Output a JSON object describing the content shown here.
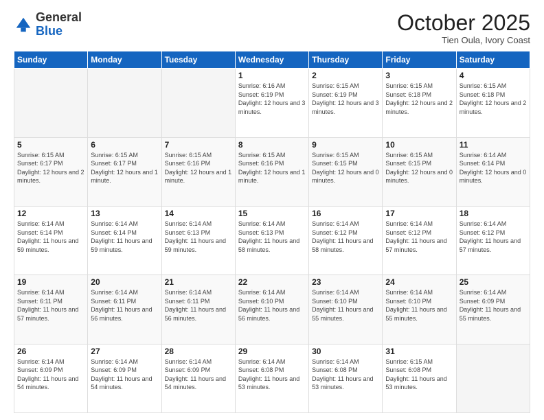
{
  "header": {
    "logo_general": "General",
    "logo_blue": "Blue",
    "month": "October 2025",
    "location": "Tien Oula, Ivory Coast"
  },
  "days_of_week": [
    "Sunday",
    "Monday",
    "Tuesday",
    "Wednesday",
    "Thursday",
    "Friday",
    "Saturday"
  ],
  "weeks": [
    [
      {
        "day": "",
        "info": ""
      },
      {
        "day": "",
        "info": ""
      },
      {
        "day": "",
        "info": ""
      },
      {
        "day": "1",
        "info": "Sunrise: 6:16 AM\nSunset: 6:19 PM\nDaylight: 12 hours and 3 minutes."
      },
      {
        "day": "2",
        "info": "Sunrise: 6:15 AM\nSunset: 6:19 PM\nDaylight: 12 hours and 3 minutes."
      },
      {
        "day": "3",
        "info": "Sunrise: 6:15 AM\nSunset: 6:18 PM\nDaylight: 12 hours and 2 minutes."
      },
      {
        "day": "4",
        "info": "Sunrise: 6:15 AM\nSunset: 6:18 PM\nDaylight: 12 hours and 2 minutes."
      }
    ],
    [
      {
        "day": "5",
        "info": "Sunrise: 6:15 AM\nSunset: 6:17 PM\nDaylight: 12 hours and 2 minutes."
      },
      {
        "day": "6",
        "info": "Sunrise: 6:15 AM\nSunset: 6:17 PM\nDaylight: 12 hours and 1 minute."
      },
      {
        "day": "7",
        "info": "Sunrise: 6:15 AM\nSunset: 6:16 PM\nDaylight: 12 hours and 1 minute."
      },
      {
        "day": "8",
        "info": "Sunrise: 6:15 AM\nSunset: 6:16 PM\nDaylight: 12 hours and 1 minute."
      },
      {
        "day": "9",
        "info": "Sunrise: 6:15 AM\nSunset: 6:15 PM\nDaylight: 12 hours and 0 minutes."
      },
      {
        "day": "10",
        "info": "Sunrise: 6:15 AM\nSunset: 6:15 PM\nDaylight: 12 hours and 0 minutes."
      },
      {
        "day": "11",
        "info": "Sunrise: 6:14 AM\nSunset: 6:14 PM\nDaylight: 12 hours and 0 minutes."
      }
    ],
    [
      {
        "day": "12",
        "info": "Sunrise: 6:14 AM\nSunset: 6:14 PM\nDaylight: 11 hours and 59 minutes."
      },
      {
        "day": "13",
        "info": "Sunrise: 6:14 AM\nSunset: 6:14 PM\nDaylight: 11 hours and 59 minutes."
      },
      {
        "day": "14",
        "info": "Sunrise: 6:14 AM\nSunset: 6:13 PM\nDaylight: 11 hours and 59 minutes."
      },
      {
        "day": "15",
        "info": "Sunrise: 6:14 AM\nSunset: 6:13 PM\nDaylight: 11 hours and 58 minutes."
      },
      {
        "day": "16",
        "info": "Sunrise: 6:14 AM\nSunset: 6:12 PM\nDaylight: 11 hours and 58 minutes."
      },
      {
        "day": "17",
        "info": "Sunrise: 6:14 AM\nSunset: 6:12 PM\nDaylight: 11 hours and 57 minutes."
      },
      {
        "day": "18",
        "info": "Sunrise: 6:14 AM\nSunset: 6:12 PM\nDaylight: 11 hours and 57 minutes."
      }
    ],
    [
      {
        "day": "19",
        "info": "Sunrise: 6:14 AM\nSunset: 6:11 PM\nDaylight: 11 hours and 57 minutes."
      },
      {
        "day": "20",
        "info": "Sunrise: 6:14 AM\nSunset: 6:11 PM\nDaylight: 11 hours and 56 minutes."
      },
      {
        "day": "21",
        "info": "Sunrise: 6:14 AM\nSunset: 6:11 PM\nDaylight: 11 hours and 56 minutes."
      },
      {
        "day": "22",
        "info": "Sunrise: 6:14 AM\nSunset: 6:10 PM\nDaylight: 11 hours and 56 minutes."
      },
      {
        "day": "23",
        "info": "Sunrise: 6:14 AM\nSunset: 6:10 PM\nDaylight: 11 hours and 55 minutes."
      },
      {
        "day": "24",
        "info": "Sunrise: 6:14 AM\nSunset: 6:10 PM\nDaylight: 11 hours and 55 minutes."
      },
      {
        "day": "25",
        "info": "Sunrise: 6:14 AM\nSunset: 6:09 PM\nDaylight: 11 hours and 55 minutes."
      }
    ],
    [
      {
        "day": "26",
        "info": "Sunrise: 6:14 AM\nSunset: 6:09 PM\nDaylight: 11 hours and 54 minutes."
      },
      {
        "day": "27",
        "info": "Sunrise: 6:14 AM\nSunset: 6:09 PM\nDaylight: 11 hours and 54 minutes."
      },
      {
        "day": "28",
        "info": "Sunrise: 6:14 AM\nSunset: 6:09 PM\nDaylight: 11 hours and 54 minutes."
      },
      {
        "day": "29",
        "info": "Sunrise: 6:14 AM\nSunset: 6:08 PM\nDaylight: 11 hours and 53 minutes."
      },
      {
        "day": "30",
        "info": "Sunrise: 6:14 AM\nSunset: 6:08 PM\nDaylight: 11 hours and 53 minutes."
      },
      {
        "day": "31",
        "info": "Sunrise: 6:15 AM\nSunset: 6:08 PM\nDaylight: 11 hours and 53 minutes."
      },
      {
        "day": "",
        "info": ""
      }
    ]
  ]
}
